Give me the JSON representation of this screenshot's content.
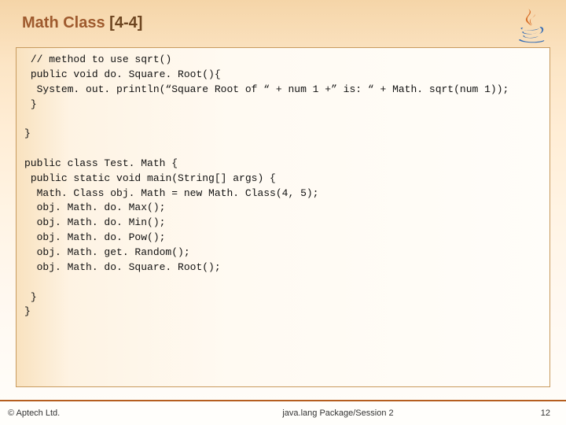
{
  "header": {
    "title_prefix": "Math Class ",
    "title_bracket": "[4-4]"
  },
  "code": {
    "lines": " // method to use sqrt()\n public void do. Square. Root(){\n  System. out. println(“Square Root of “ + num 1 +” is: “ + Math. sqrt(num 1));\n }\n\n}\n\npublic class Test. Math {\n public static void main(String[] args) {\n  Math. Class obj. Math = new Math. Class(4, 5);\n  obj. Math. do. Max();\n  obj. Math. do. Min();\n  obj. Math. do. Pow();\n  obj. Math. get. Random();\n  obj. Math. do. Square. Root();\n\n }\n}"
  },
  "footer": {
    "copyright": "© Aptech Ltd.",
    "breadcrumb": "java.lang Package/Session 2",
    "page_number": "12"
  }
}
